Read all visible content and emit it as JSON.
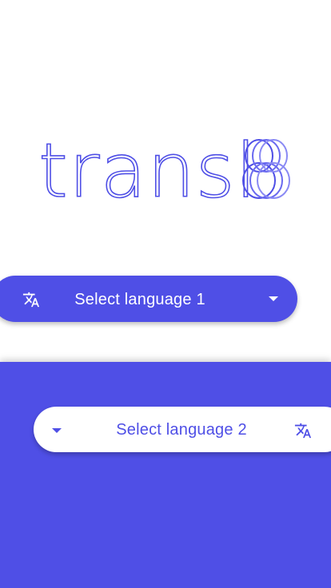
{
  "app": {
    "logo_text": "transl8",
    "brand_color": "#4f4fe6",
    "background_color": "#ffffff"
  },
  "language_selector_1": {
    "label": "Select language 1",
    "icon": "translate-icon",
    "dropdown_icon": "caret-down-icon"
  },
  "language_selector_2": {
    "label": "Select language 2",
    "icon": "translate-icon",
    "dropdown_icon": "caret-down-icon"
  }
}
